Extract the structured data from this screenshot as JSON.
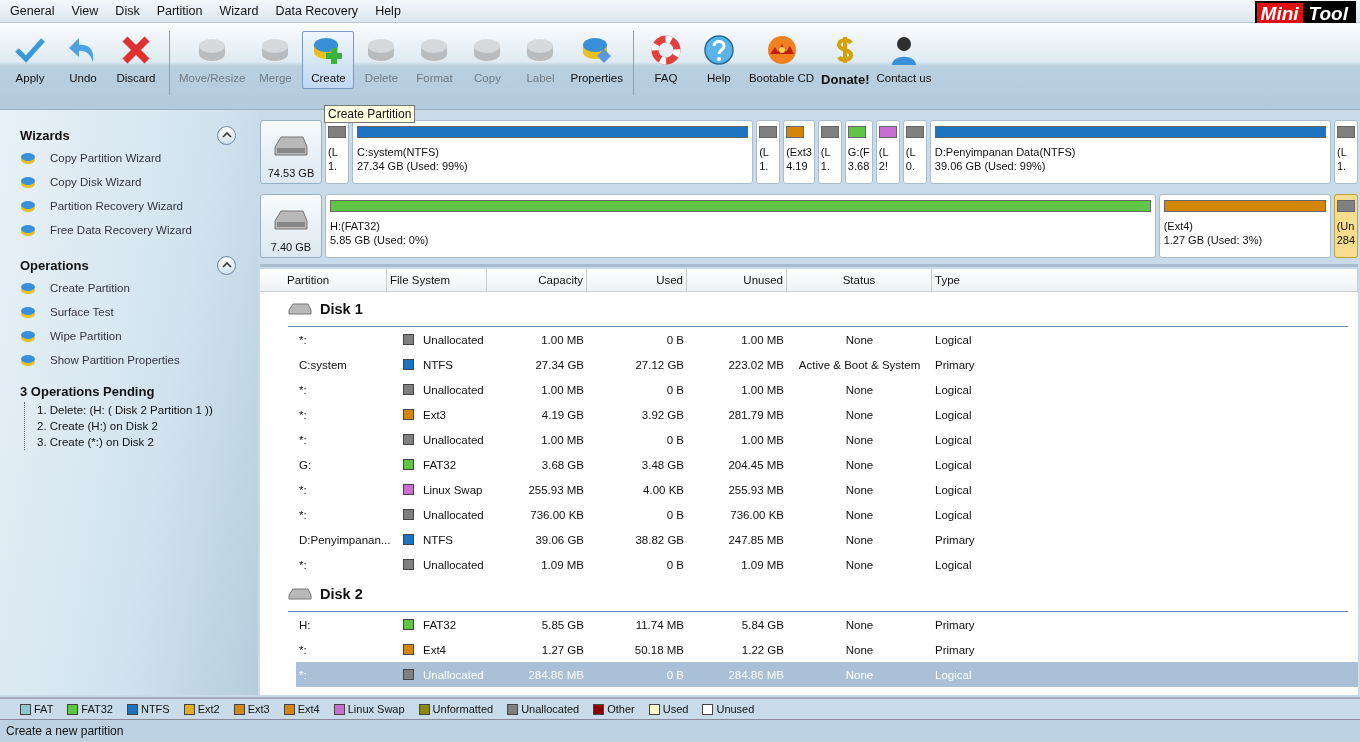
{
  "menu": [
    "General",
    "View",
    "Disk",
    "Partition",
    "Wizard",
    "Data Recovery",
    "Help"
  ],
  "logo": {
    "part_1": "Mini",
    "part_2": "Tool"
  },
  "toolbar": [
    {
      "label": "Apply",
      "disabled": false
    },
    {
      "label": "Undo",
      "disabled": false
    },
    {
      "label": "Discard",
      "disabled": false
    },
    {
      "label": "Move/Resize",
      "disabled": true
    },
    {
      "label": "Merge",
      "disabled": true
    },
    {
      "label": "Create",
      "disabled": false,
      "selected": true
    },
    {
      "label": "Delete",
      "disabled": true
    },
    {
      "label": "Format",
      "disabled": true
    },
    {
      "label": "Copy",
      "disabled": true
    },
    {
      "label": "Label",
      "disabled": true
    },
    {
      "label": "Properties",
      "disabled": false
    },
    {
      "label": "FAQ",
      "disabled": false
    },
    {
      "label": "Help",
      "disabled": false
    },
    {
      "label": "Bootable CD",
      "disabled": false
    },
    {
      "label": "Donate!",
      "disabled": false,
      "bold": true
    },
    {
      "label": "Contact us",
      "disabled": false
    }
  ],
  "tooltip": "Create Partition",
  "sidebar": {
    "sections": [
      {
        "title": "Wizards",
        "items": [
          "Copy Partition Wizard",
          "Copy Disk Wizard",
          "Partition Recovery Wizard",
          "Free Data Recovery Wizard"
        ]
      },
      {
        "title": "Operations",
        "items": [
          "Create Partition",
          "Surface Test",
          "Wipe Partition",
          "Show Partition Properties"
        ]
      }
    ],
    "pending": {
      "title": "3 Operations Pending",
      "items": [
        "1. Delete: (H: ( Disk 2 Partition 1 ))",
        "2. Create (H:) on Disk 2",
        "3. Create (*:) on Disk 2"
      ]
    }
  },
  "disk_map": [
    {
      "size": "74.53 GB",
      "partitions": [
        {
          "line_1": "(L",
          "line_2": "1.",
          "color": "#808080",
          "kind": "narrow",
          "selected": false
        },
        {
          "line_1": "C:system(NTFS)",
          "line_2": "27.34 GB (Used: 99%)",
          "color": "#1e73be",
          "kind": "wide",
          "selected": false
        },
        {
          "line_1": "(L",
          "line_2": "1.",
          "color": "#808080",
          "kind": "narrow",
          "selected": false
        },
        {
          "line_1": "(Ext3",
          "line_2": "4.19",
          "color": "#d4860b",
          "kind": "narrow",
          "selected": false
        },
        {
          "line_1": "(L",
          "line_2": "1.",
          "color": "#808080",
          "kind": "narrow",
          "selected": false
        },
        {
          "line_1": "G:(F",
          "line_2": "3.68",
          "color": "#5ec545",
          "kind": "narrow",
          "selected": false
        },
        {
          "line_1": "(L",
          "line_2": "2!",
          "color": "#c86ed0",
          "kind": "narrow",
          "selected": false
        },
        {
          "line_1": "(L",
          "line_2": "0.",
          "color": "#808080",
          "kind": "narrow",
          "selected": false
        },
        {
          "line_1": "D:Penyimpanan Data(NTFS)",
          "line_2": "39.06 GB (Used: 99%)",
          "color": "#1e73be",
          "kind": "wide",
          "selected": false
        },
        {
          "line_1": "(L",
          "line_2": "1.",
          "color": "#808080",
          "kind": "narrow",
          "selected": false
        }
      ]
    },
    {
      "size": "7.40 GB",
      "partitions": [
        {
          "line_1": "H:(FAT32)",
          "line_2": "5.85 GB (Used: 0%)",
          "color": "#5ec545",
          "kind": "wide",
          "selected": false
        },
        {
          "line_1": "(Ext4)",
          "line_2": "1.27 GB (Used: 3%)",
          "color": "#d4860b",
          "kind": "medium",
          "selected": false
        },
        {
          "line_1": "(Un",
          "line_2": "284",
          "color": "#808080",
          "kind": "narrow",
          "selected": true
        }
      ]
    }
  ],
  "table": {
    "columns": [
      "Partition",
      "File System",
      "Capacity",
      "Used",
      "Unused",
      "Status",
      "Type"
    ],
    "disks": [
      {
        "name": "Disk 1",
        "rows": [
          {
            "partition": "*:",
            "fs": "Unallocated",
            "color": "#808080",
            "capacity": "1.00 MB",
            "used": "0 B",
            "unused": "1.00 MB",
            "status": "None",
            "type": "Logical",
            "selected": false
          },
          {
            "partition": "C:system",
            "fs": "NTFS",
            "color": "#1e73be",
            "capacity": "27.34 GB",
            "used": "27.12 GB",
            "unused": "223.02 MB",
            "status": "Active & Boot & System",
            "type": "Primary",
            "selected": false
          },
          {
            "partition": "*:",
            "fs": "Unallocated",
            "color": "#808080",
            "capacity": "1.00 MB",
            "used": "0 B",
            "unused": "1.00 MB",
            "status": "None",
            "type": "Logical",
            "selected": false
          },
          {
            "partition": "*:",
            "fs": "Ext3",
            "color": "#d4860b",
            "capacity": "4.19 GB",
            "used": "3.92 GB",
            "unused": "281.79 MB",
            "status": "None",
            "type": "Logical",
            "selected": false
          },
          {
            "partition": "*:",
            "fs": "Unallocated",
            "color": "#808080",
            "capacity": "1.00 MB",
            "used": "0 B",
            "unused": "1.00 MB",
            "status": "None",
            "type": "Logical",
            "selected": false
          },
          {
            "partition": "G:",
            "fs": "FAT32",
            "color": "#5ec545",
            "capacity": "3.68 GB",
            "used": "3.48 GB",
            "unused": "204.45 MB",
            "status": "None",
            "type": "Logical",
            "selected": false
          },
          {
            "partition": "*:",
            "fs": "Linux Swap",
            "color": "#c86ed0",
            "capacity": "255.93 MB",
            "used": "4.00 KB",
            "unused": "255.93 MB",
            "status": "None",
            "type": "Logical",
            "selected": false
          },
          {
            "partition": "*:",
            "fs": "Unallocated",
            "color": "#808080",
            "capacity": "736.00 KB",
            "used": "0 B",
            "unused": "736.00 KB",
            "status": "None",
            "type": "Logical",
            "selected": false
          },
          {
            "partition": "D:Penyimpanan...",
            "fs": "NTFS",
            "color": "#1e73be",
            "capacity": "39.06 GB",
            "used": "38.82 GB",
            "unused": "247.85 MB",
            "status": "None",
            "type": "Primary",
            "selected": false
          },
          {
            "partition": "*:",
            "fs": "Unallocated",
            "color": "#808080",
            "capacity": "1.09 MB",
            "used": "0 B",
            "unused": "1.09 MB",
            "status": "None",
            "type": "Logical",
            "selected": false
          }
        ]
      },
      {
        "name": "Disk 2",
        "rows": [
          {
            "partition": "H:",
            "fs": "FAT32",
            "color": "#5ec545",
            "capacity": "5.85 GB",
            "used": "11.74 MB",
            "unused": "5.84 GB",
            "status": "None",
            "type": "Primary",
            "selected": false
          },
          {
            "partition": "*:",
            "fs": "Ext4",
            "color": "#d4860b",
            "capacity": "1.27 GB",
            "used": "50.18 MB",
            "unused": "1.22 GB",
            "status": "None",
            "type": "Primary",
            "selected": false
          },
          {
            "partition": "*:",
            "fs": "Unallocated",
            "color": "#808080",
            "capacity": "284.86 MB",
            "used": "0 B",
            "unused": "284.86 MB",
            "status": "None",
            "type": "Logical",
            "selected": true
          }
        ]
      }
    ]
  },
  "legend": [
    {
      "label": "FAT",
      "color": "#8fc8d0"
    },
    {
      "label": "FAT32",
      "color": "#5ec545"
    },
    {
      "label": "NTFS",
      "color": "#1e73be"
    },
    {
      "label": "Ext2",
      "color": "#e0b020"
    },
    {
      "label": "Ext3",
      "color": "#d4860b"
    },
    {
      "label": "Ext4",
      "color": "#d4860b"
    },
    {
      "label": "Linux Swap",
      "color": "#c86ed0"
    },
    {
      "label": "Unformatted",
      "color": "#8a8a10"
    },
    {
      "label": "Unallocated",
      "color": "#808080"
    },
    {
      "label": "Other",
      "color": "#8b0000"
    },
    {
      "label": "Used",
      "color": "#fff8c8"
    },
    {
      "label": "Unused",
      "color": "#ffffff"
    }
  ],
  "status_bar": "Create a new partition"
}
